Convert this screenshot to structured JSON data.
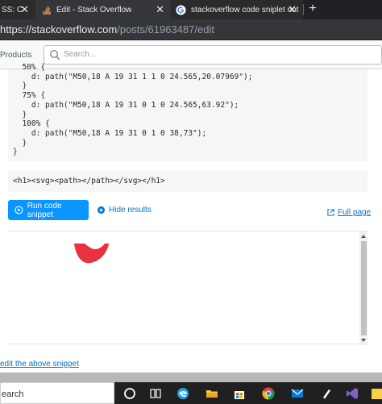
{
  "browser": {
    "tabs": [
      {
        "label": "SS: C",
        "active": false
      },
      {
        "label": "Edit - Stack Overflow",
        "active": true
      },
      {
        "label": "stackoverflow code sniplet not w",
        "active": false
      }
    ],
    "new_tab_label": "+",
    "close_glyph": "✕",
    "url_host": "https://stackoverflow.com",
    "url_path": "/posts/61963487/edit"
  },
  "so_header": {
    "products_label": "Products",
    "search_placeholder": "Search..."
  },
  "code_block": {
    "text": "  50% {\n    d: path(\"M50,18 A 19 31 1 1 0 24.565,20.07969\");\n  }\n  75% {\n    d: path(\"M50,18 A 19 31 0 1 0 24.565,63.92\");\n  }\n  100% {\n    d: path(\"M50,18 A 19 31 0 1 0 38,73\");\n  }\n}"
  },
  "html_block": {
    "text": "<h1><svg><path></path></svg></h1>"
  },
  "snippet": {
    "run_label": "Run code snippet",
    "hide_label": "Hide results",
    "full_page_label": "Full page",
    "edit_link_label": "edit the above snippet"
  },
  "taskbar": {
    "search_label": "earch"
  },
  "icons": [
    "stackoverflow-tab-icon",
    "google-tab-icon",
    "search-icon",
    "run-icon",
    "hide-icon",
    "expand-icon",
    "scroll-up-icon",
    "scroll-down-icon",
    "cortana-icon",
    "task-view-icon",
    "edge-icon",
    "file-explorer-icon",
    "store-icon",
    "chrome-icon",
    "mail-icon",
    "pen-icon",
    "visual-studio-icon",
    "notes-icon"
  ],
  "colors": {
    "so_blue": "#0a95ff",
    "link_blue": "#0074cc",
    "shape_red": "#e8333f"
  }
}
